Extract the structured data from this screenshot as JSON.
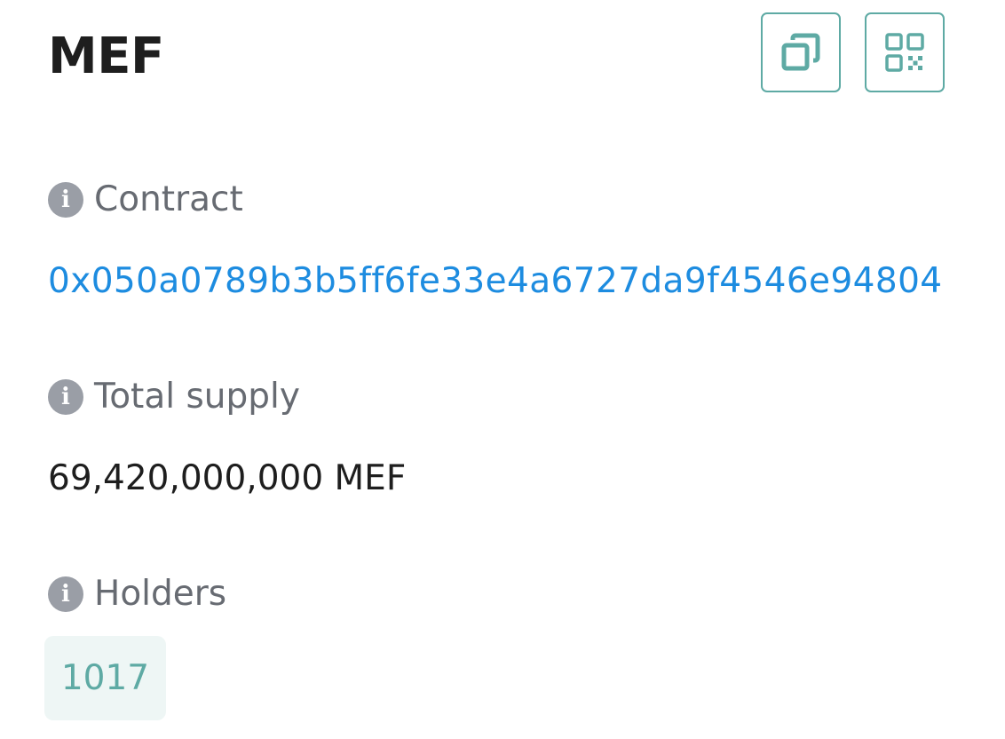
{
  "token": {
    "symbol": "MEF"
  },
  "header": {
    "copy_icon": "copy-icon",
    "qr_icon": "qr-code-icon",
    "accent_color": "#5eaaa4"
  },
  "contract": {
    "label": "Contract",
    "address": "0x050a0789b3b5ff6fe33e4a6727da9f4546e94804",
    "link_color": "#1d8ce0"
  },
  "total_supply": {
    "label": "Total supply",
    "value": "69,420,000,000 MEF"
  },
  "holders": {
    "label": "Holders",
    "count": "1017"
  },
  "info_icon": {
    "glyph": "i"
  }
}
